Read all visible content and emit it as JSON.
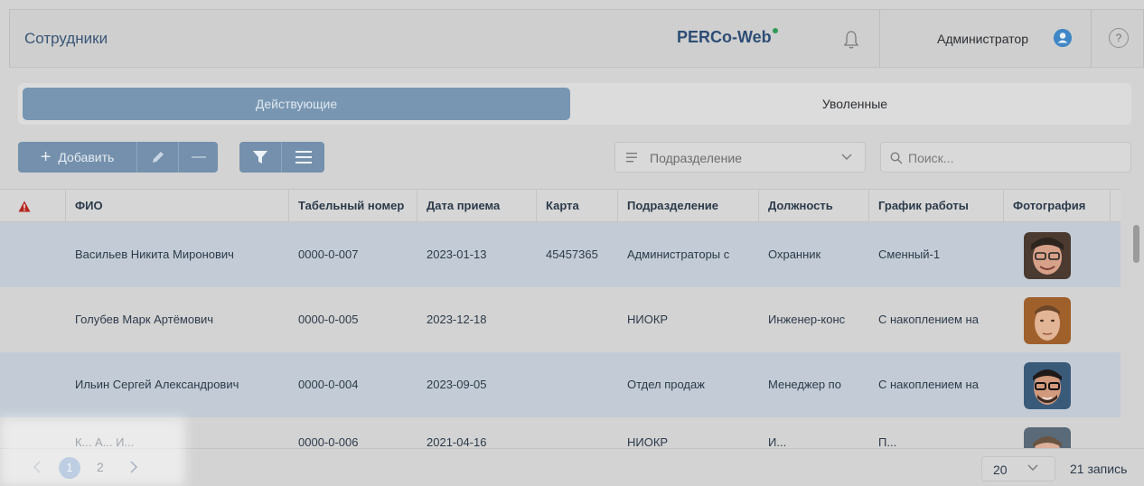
{
  "header": {
    "title": "Сотрудники",
    "logo": "PERCo-Web",
    "user_name": "Администратор",
    "help": "?"
  },
  "tabs": [
    {
      "label": "Действующие",
      "active": true
    },
    {
      "label": "Уволенные",
      "active": false
    }
  ],
  "toolbar": {
    "add_label": "Добавить",
    "department_placeholder": "Подразделение",
    "search_placeholder": "Поиск..."
  },
  "table": {
    "columns": [
      "ФИО",
      "Табельный номер",
      "Дата приема",
      "Карта",
      "Подразделение",
      "Должность",
      "График работы",
      "Фотография"
    ],
    "rows": [
      {
        "fio": "Васильев Никита Миронович",
        "tab": "0000-0-007",
        "date": "2023-01-13",
        "card": "45457365",
        "dept": "Администраторы с",
        "position": "Охранник",
        "schedule": "Сменный-1",
        "photo": "face-1"
      },
      {
        "fio": "Голубев Марк Артёмович",
        "tab": "0000-0-005",
        "date": "2023-12-18",
        "card": "",
        "dept": "НИОКР",
        "position": "Инженер-конс",
        "schedule": "С накоплением на",
        "photo": "face-2"
      },
      {
        "fio": "Ильин Сергей Александрович",
        "tab": "0000-0-004",
        "date": "2023-09-05",
        "card": "",
        "dept": "Отдел продаж",
        "position": "Менеджер по",
        "schedule": "С накоплением на",
        "photo": "face-3"
      },
      {
        "fio": "К... А... И...",
        "tab": "0000-0-006",
        "date": "2021-04-16",
        "card": "",
        "dept": "НИОКР",
        "position": "И...",
        "schedule": "П...",
        "photo": "face-4"
      }
    ]
  },
  "footer": {
    "pages": [
      "1",
      "2"
    ],
    "current_page": "1",
    "page_size": "20",
    "count": "21 запись"
  },
  "colors": {
    "accent": "#7896b1",
    "row_highlight": "#c3ccd6",
    "warning": "#b3261e",
    "logo_dot": "#2f9a57"
  }
}
